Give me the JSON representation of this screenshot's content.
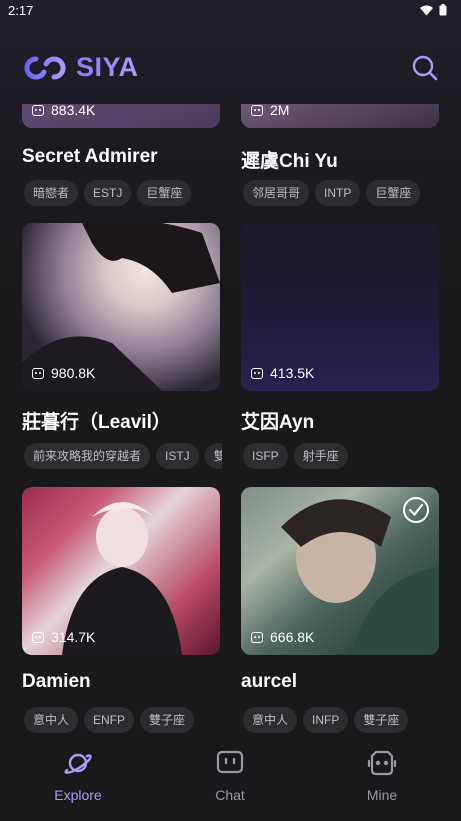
{
  "status_bar": {
    "time": "2:17"
  },
  "app": {
    "name": "SIYA"
  },
  "cards": [
    {
      "stat": "883.4K",
      "name": "Secret Admirer",
      "tags": [
        "暗戀者",
        "ESTJ",
        "巨蟹座"
      ]
    },
    {
      "stat": "2M",
      "name": "遲虞Chi Yu",
      "tags": [
        "邻居哥哥",
        "INTP",
        "巨蟹座"
      ]
    },
    {
      "stat": "980.8K",
      "name": "莊暮行（Leavil）",
      "tags": [
        "前来攻略我的穿越者",
        "ISTJ",
        "雙"
      ]
    },
    {
      "stat": "413.5K",
      "name": "艾因Ayn",
      "tags": [
        "ISFP",
        "射手座"
      ]
    },
    {
      "stat": "314.7K",
      "name": "Damien",
      "tags": [
        "意中人",
        "ENFP",
        "雙子座"
      ]
    },
    {
      "stat": "666.8K",
      "name": "aurcel",
      "tags": [
        "意中人",
        "INFP",
        "雙子座"
      ]
    }
  ],
  "nav": [
    {
      "label": "Explore",
      "icon": "planet-icon",
      "active": true
    },
    {
      "label": "Chat",
      "icon": "chat-icon",
      "active": false
    },
    {
      "label": "Mine",
      "icon": "robot-face-icon",
      "active": false
    }
  ],
  "colors": {
    "accent": "#a89cf7",
    "background": "#19191b",
    "tag_bg": "#2d2d30"
  }
}
